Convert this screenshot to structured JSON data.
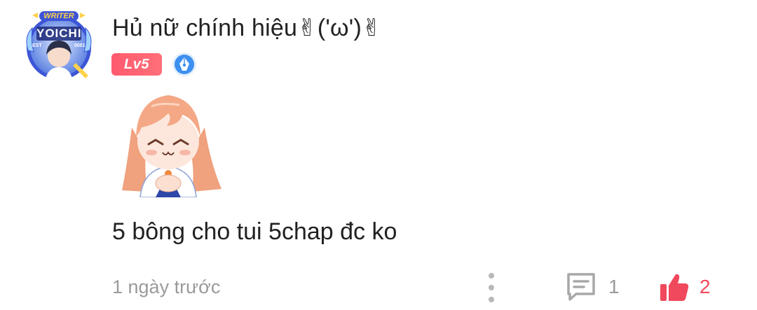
{
  "comment": {
    "avatar": {
      "frame_label": "WRITER",
      "name_text": "YOICHI",
      "est_text": "EST",
      "num_text": "0001",
      "icon": "avatar-icon"
    },
    "username": "Hủ nữ chính hiệu✌('ω')✌",
    "level_badge": "Lv5",
    "writer_badge_icon": "pen-nib-icon",
    "sticker_icon": "anime-girl-sticker-icon",
    "text": "5 bông cho tui 5chap đc ko",
    "timestamp": "1 ngày trước",
    "reply_count": "1",
    "like_count": "2",
    "colors": {
      "accent": "#f0485c",
      "level_badge": "#ff5a6e",
      "writer_badge": "#3d8ff0",
      "muted_text": "#9a9a9a",
      "main_text": "#222222"
    }
  }
}
